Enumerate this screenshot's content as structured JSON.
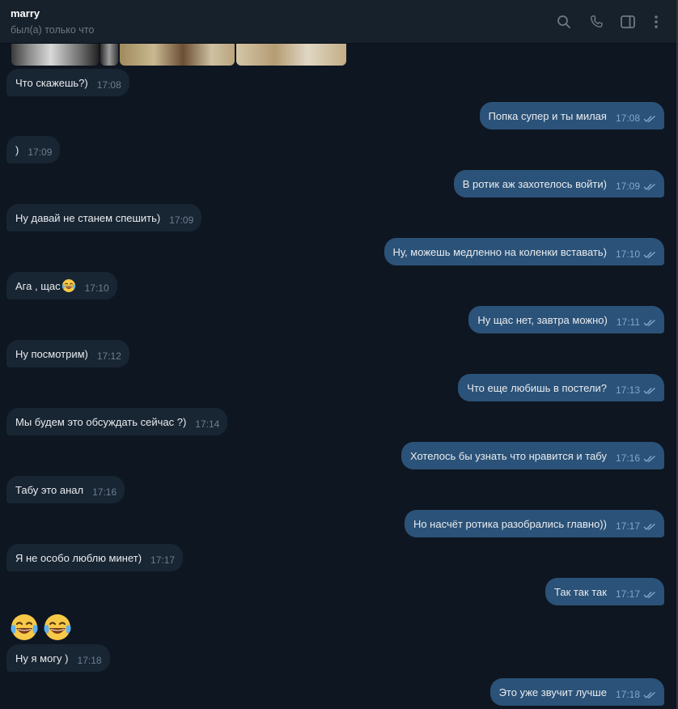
{
  "header": {
    "name": "marry",
    "status": "был(а) только что"
  },
  "messages": [
    {
      "dir": "in",
      "text": "Что скажешь?)",
      "time": "17:08"
    },
    {
      "dir": "out",
      "text": "Попка супер и ты милая",
      "time": "17:08"
    },
    {
      "dir": "in",
      "text": ")",
      "time": "17:09"
    },
    {
      "dir": "out",
      "text": "В ротик аж захотелось войти)",
      "time": "17:09"
    },
    {
      "dir": "in",
      "text": "Ну давай не станем спешить)",
      "time": "17:09"
    },
    {
      "dir": "out",
      "text": "Ну, можешь медленно на коленки вставать)",
      "time": "17:10"
    },
    {
      "dir": "in",
      "text": "Ага , щас",
      "time": "17:10"
    },
    {
      "dir": "out",
      "text": "Ну щас нет, завтра можно)",
      "time": "17:11"
    },
    {
      "dir": "in",
      "text": "Ну посмотрим)",
      "time": "17:12"
    },
    {
      "dir": "out",
      "text": "Что еще любишь в постели?",
      "time": "17:13"
    },
    {
      "dir": "in",
      "text": "Мы будем это обсуждать сейчас ?)",
      "time": "17:14"
    },
    {
      "dir": "out",
      "text": "Хотелось бы узнать что нравится и табу",
      "time": "17:16"
    },
    {
      "dir": "in",
      "text": "Табу это анал",
      "time": "17:16"
    },
    {
      "dir": "out",
      "text": "Но насчёт ротика разобрались главно))",
      "time": "17:17"
    },
    {
      "dir": "in",
      "text": "Я не особо люблю минет)",
      "time": "17:17"
    },
    {
      "dir": "out",
      "text": "Так так так",
      "time": "17:17"
    },
    {
      "dir": "in",
      "text": "Ну я могу )",
      "time": "17:18"
    },
    {
      "dir": "out",
      "text": "Это уже звучит лучше",
      "time": "17:18"
    }
  ],
  "colors": {
    "background": "#0e1621",
    "incoming_bubble": "#182533",
    "outgoing_bubble": "#2b5278",
    "header": "#17212b"
  },
  "icons": [
    "search-icon",
    "phone-icon",
    "sidebar-toggle-icon",
    "more-vertical-icon",
    "double-check-icon",
    "laughing-emoji-icon"
  ]
}
